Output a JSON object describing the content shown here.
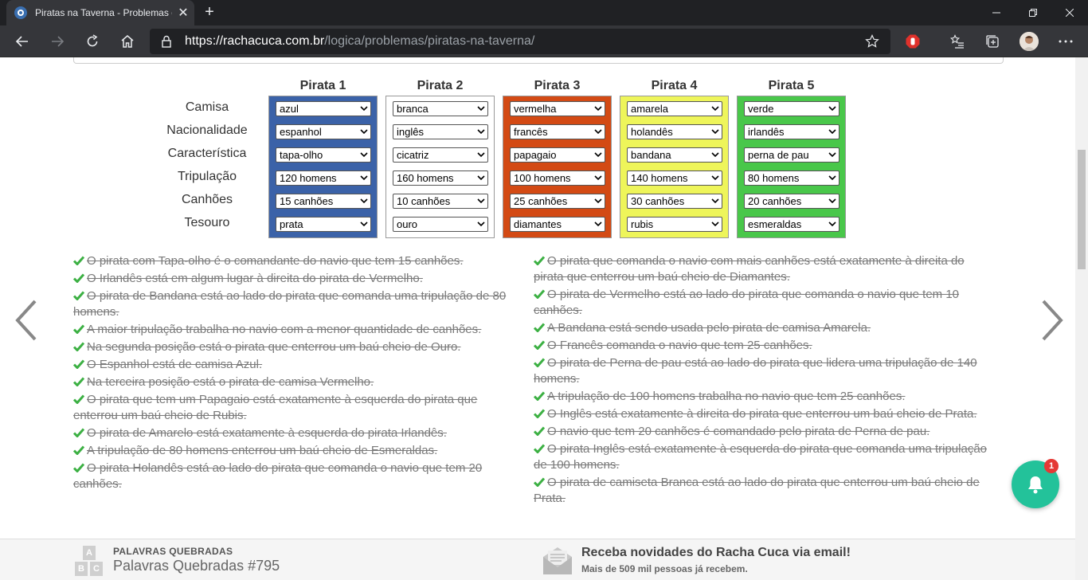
{
  "browser": {
    "tab_title": "Piratas na Taverna - Problemas de Lógica - Racha Cuca",
    "url_scheme": "https://",
    "url_host": "rachacuca.com.br",
    "url_path": "/logica/problemas/piratas-na-taverna/",
    "new_tab_symbol": "+",
    "close_symbol": "✕"
  },
  "puzzle": {
    "row_labels": [
      "Camisa",
      "Nacionalidade",
      "Característica",
      "Tripulação",
      "Canhões",
      "Tesouro"
    ],
    "pirates": [
      {
        "title": "Pirata 1",
        "color": "#3b62a8",
        "values": [
          "azul",
          "espanhol",
          "tapa-olho",
          "120 homens",
          "15 canhões",
          "prata"
        ]
      },
      {
        "title": "Pirata 2",
        "color": "#ffffff",
        "values": [
          "branca",
          "inglês",
          "cicatriz",
          "160 homens",
          "10 canhões",
          "ouro"
        ]
      },
      {
        "title": "Pirata 3",
        "color": "#d34a14",
        "values": [
          "vermelha",
          "francês",
          "papagaio",
          "100 homens",
          "25 canhões",
          "diamantes"
        ]
      },
      {
        "title": "Pirata 4",
        "color": "#eef55a",
        "values": [
          "amarela",
          "holandês",
          "bandana",
          "140 homens",
          "30 canhões",
          "rubis"
        ]
      },
      {
        "title": "Pirata 5",
        "color": "#49c74a",
        "values": [
          "verde",
          "irlandês",
          "perna de pau",
          "80 homens",
          "20 canhões",
          "esmeraldas"
        ]
      }
    ]
  },
  "clues_left": [
    "O pirata com Tapa-olho é o comandante do navio que tem 15 canhões.",
    "O Irlandês está em algum lugar à direita do pirata de Vermelho.",
    "O pirata de Bandana está ao lado do pirata que comanda uma tripulação de 80 homens.",
    "A maior tripulação trabalha no navio com a menor quantidade de canhões.",
    "Na segunda posição está o pirata que enterrou um baú cheio de Ouro.",
    "O Espanhol está de camisa Azul.",
    "Na terceira posição está o pirata de camisa Vermelho.",
    "O pirata que tem um Papagaio está exatamente à esquerda do pirata que enterrou um baú cheio de Rubis.",
    "O pirata de Amarelo está exatamente à esquerda do pirata Irlandês.",
    "A tripulação de 80 homens enterrou um baú cheio de Esmeraldas.",
    "O pirata Holandês está ao lado do pirata que comanda o navio que tem 20 canhões."
  ],
  "clues_right": [
    "O pirata que comanda o navio com mais canhões está exatamente à direita do pirata que enterrou um baú cheio de Diamantes.",
    "O pirata de Vermelho está ao lado do pirata que comanda o navio que tem 10 canhões.",
    "A Bandana está sendo usada pelo pirata de camisa Amarela.",
    "O Francês comanda o navio que tem 25 canhões.",
    "O pirata de Perna de pau está ao lado do pirata que lidera uma tripulação de 140 homens.",
    "A tripulação de 100 homens trabalha no navio que tem 25 canhões.",
    "O Inglês está exatamente à direita do pirata que enterrou um baú cheio de Prata.",
    "O navio que tem 20 canhões é comandado pelo pirata de Perna de pau.",
    "O pirata Inglês está exatamente à esquerda do pirata que comanda uma tripulação de 100 homens.",
    "O pirata de camiseta Branca está ao lado do pirata que enterrou um baú cheio de Prata."
  ],
  "footer": {
    "abc_letters": [
      "A",
      "B",
      "C"
    ],
    "section_label": "PALAVRAS QUEBRADAS",
    "item_title": "Palavras Quebradas #795",
    "newsletter_title": "Receba novidades do Racha Cuca via email!",
    "newsletter_sub": "Mais de 509 mil pessoas já recebem."
  },
  "notifications": {
    "badge_count": "1"
  },
  "colors": {
    "check_green": "#3cb043",
    "accent_teal": "#23c29a"
  }
}
